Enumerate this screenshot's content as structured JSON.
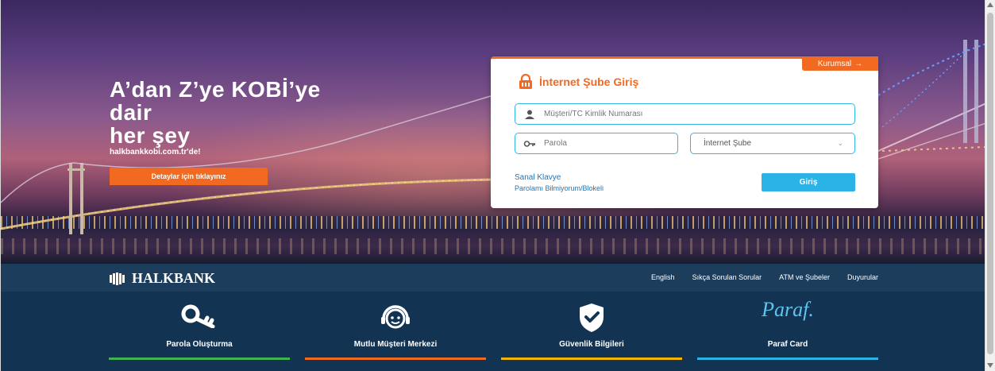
{
  "hero": {
    "title_line1": "A’dan Z’ye KOBİ’ye",
    "title_line2": "dair",
    "title_line3": "her şey",
    "subtitle": "halkbankkobi.com.tr'de!",
    "cta_label": "Detaylar için tıklayınız"
  },
  "login": {
    "corp_tab_label": "Kurumsal",
    "corp_tab_arrow": "→",
    "title": "İnternet Şube Giriş",
    "customer_placeholder": "Müşteri/TC Kimlik Numarası",
    "password_placeholder": "Parola",
    "channel_selected": "İnternet Şube",
    "virtual_keyboard_link": "Sanal Klavye",
    "forgot_link": "Parolamı Bilmiyorum/Blokeli",
    "submit_label": "Giriş"
  },
  "navbar": {
    "logo_text": "HALKBANK",
    "links": [
      "English",
      "Sıkça Sorulan Sorular",
      "ATM ve Şubeler",
      "Duyurular"
    ]
  },
  "features": [
    {
      "label": "Parola Oluşturma",
      "icon": "key-icon",
      "bar_color": "#3fb34f"
    },
    {
      "label": "Mutlu Müşteri Merkezi",
      "icon": "headset-icon",
      "bar_color": "#f26a21"
    },
    {
      "label": "Güvenlik Bilgileri",
      "icon": "shield-check-icon",
      "bar_color": "#f5b400"
    },
    {
      "label": "Paraf Card",
      "icon": "paraf-logo",
      "logo_text": "Paraf.",
      "bar_color": "#2ab3e6"
    }
  ],
  "colors": {
    "accent_orange": "#f26a21",
    "accent_blue": "#2ab3e6",
    "navbar_bg": "#1d3d5c",
    "features_bg": "#123352"
  }
}
